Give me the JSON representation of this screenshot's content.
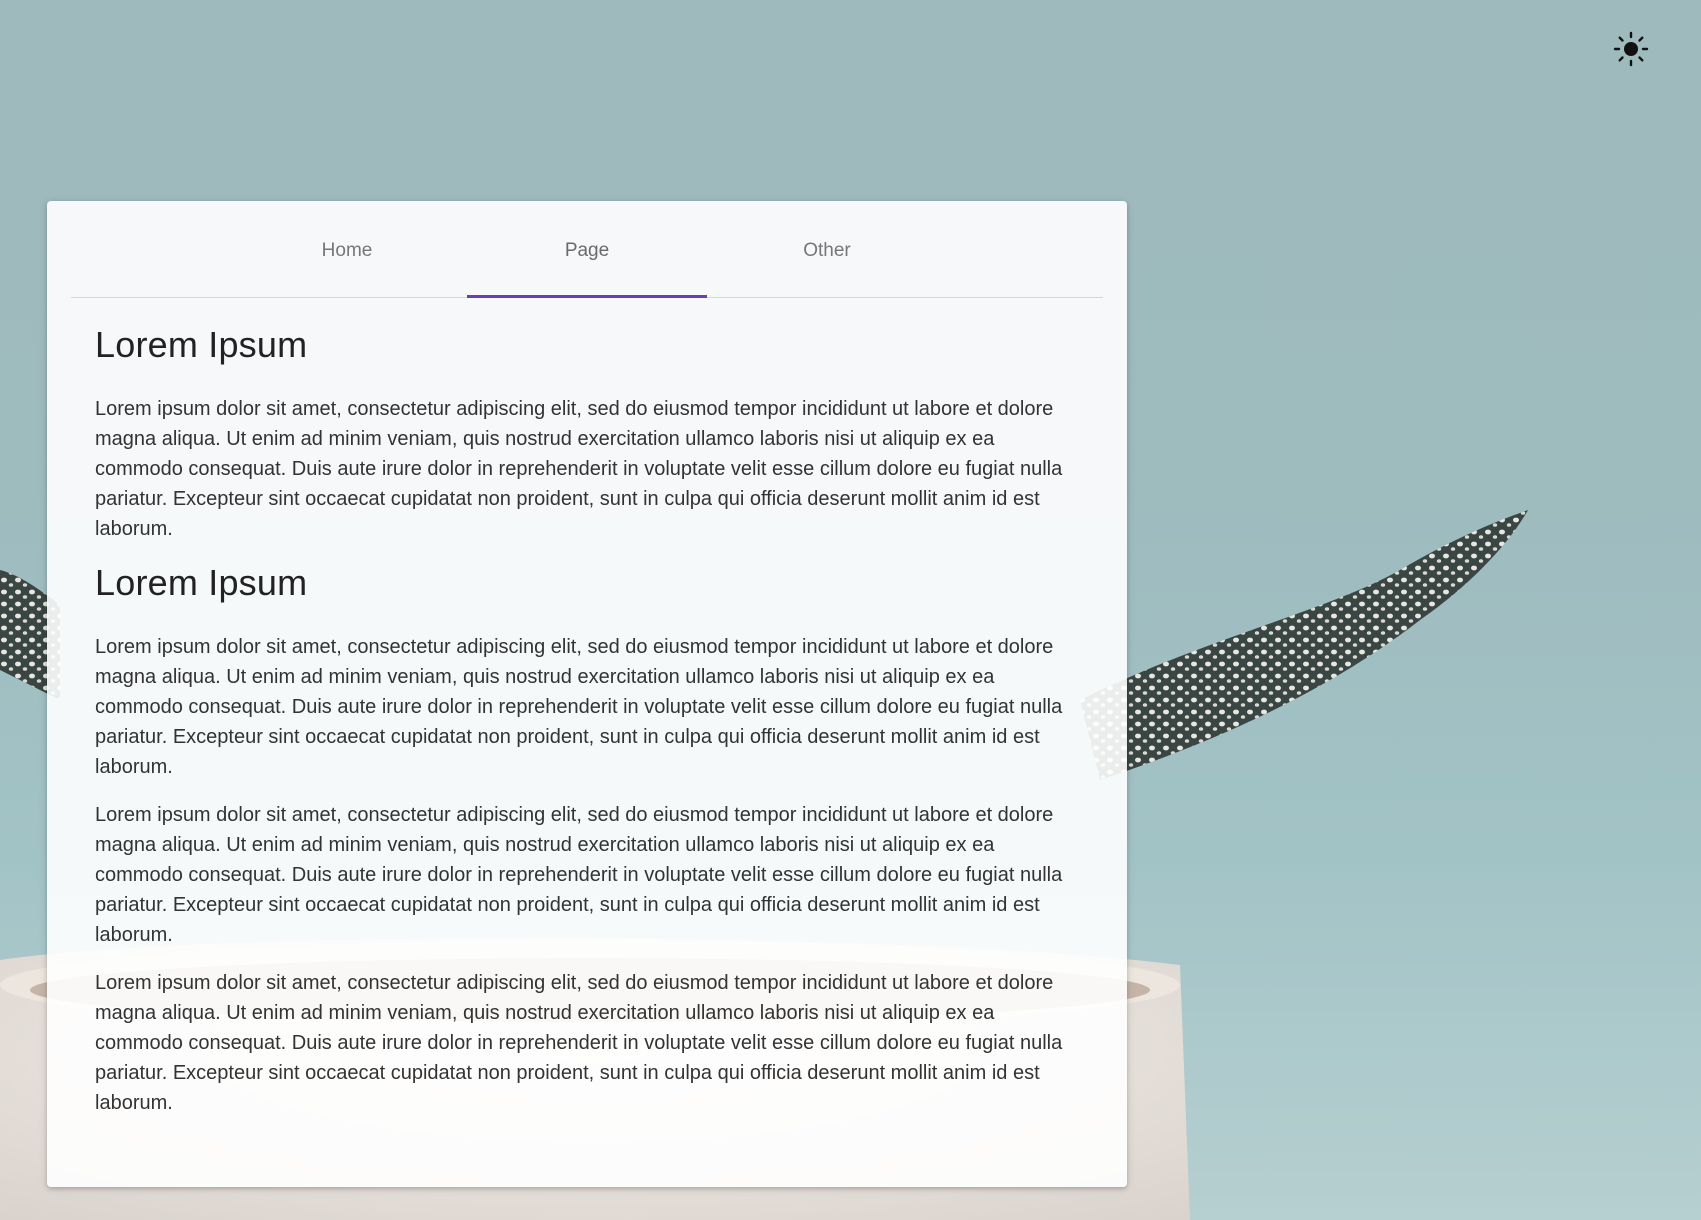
{
  "theme_toggle": {
    "icon": "sun-icon"
  },
  "tabs": [
    {
      "label": "Home",
      "active": false
    },
    {
      "label": "Page",
      "active": true
    },
    {
      "label": "Other",
      "active": false
    }
  ],
  "content": {
    "sections": [
      {
        "heading": "Lorem Ipsum",
        "paragraphs": [
          "Lorem ipsum dolor sit amet, consectetur adipiscing elit, sed do eiusmod tempor incididunt ut labore et dolore magna aliqua. Ut enim ad minim veniam, quis nostrud exercitation ullamco laboris nisi ut aliquip ex ea commodo consequat. Duis aute irure dolor in reprehenderit in voluptate velit esse cillum dolore eu fugiat nulla pariatur. Excepteur sint occaecat cupidatat non proident, sunt in culpa qui officia deserunt mollit anim id est laborum."
        ]
      },
      {
        "heading": "Lorem Ipsum",
        "paragraphs": [
          "Lorem ipsum dolor sit amet, consectetur adipiscing elit, sed do eiusmod tempor incididunt ut labore et dolore magna aliqua. Ut enim ad minim veniam, quis nostrud exercitation ullamco laboris nisi ut aliquip ex ea commodo consequat. Duis aute irure dolor in reprehenderit in voluptate velit esse cillum dolore eu fugiat nulla pariatur. Excepteur sint occaecat cupidatat non proident, sunt in culpa qui officia deserunt mollit anim id est laborum.",
          "Lorem ipsum dolor sit amet, consectetur adipiscing elit, sed do eiusmod tempor incididunt ut labore et dolore magna aliqua. Ut enim ad minim veniam, quis nostrud exercitation ullamco laboris nisi ut aliquip ex ea commodo consequat. Duis aute irure dolor in reprehenderit in voluptate velit esse cillum dolore eu fugiat nulla pariatur. Excepteur sint occaecat cupidatat non proident, sunt in culpa qui officia deserunt mollit anim id est laborum.",
          "Lorem ipsum dolor sit amet, consectetur adipiscing elit, sed do eiusmod tempor incididunt ut labore et dolore magna aliqua. Ut enim ad minim veniam, quis nostrud exercitation ullamco laboris nisi ut aliquip ex ea commodo consequat. Duis aute irure dolor in reprehenderit in voluptate velit esse cillum dolore eu fugiat nulla pariatur. Excepteur sint occaecat cupidatat non proident, sunt in culpa qui officia deserunt mollit anim id est laborum."
        ]
      }
    ]
  }
}
